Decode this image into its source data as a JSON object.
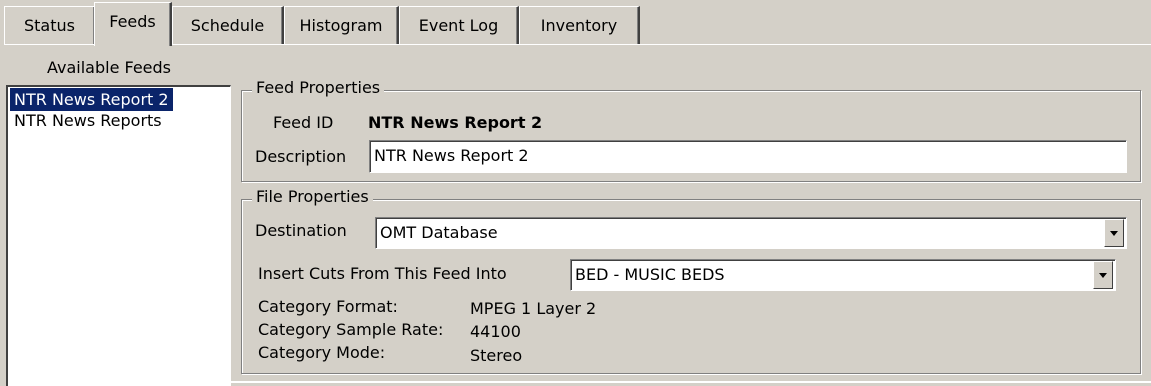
{
  "tabs": [
    "Status",
    "Feeds",
    "Schedule",
    "Histogram",
    "Event Log",
    "Inventory"
  ],
  "active_tab": "Feeds",
  "feeds_list": {
    "title": "Available Feeds",
    "items": [
      "NTR News Report 2",
      "NTR News Reports"
    ],
    "selected": "NTR News Report 2"
  },
  "feed_properties": {
    "title": "Feed Properties",
    "feed_id_label": "Feed ID",
    "feed_id_value": "NTR News Report 2",
    "description_label": "Description",
    "description_value": "NTR News Report 2"
  },
  "file_properties": {
    "title": "File Properties",
    "destination_label": "Destination",
    "destination_value": "OMT Database",
    "insert_cuts_label": "Insert Cuts From This Feed Into",
    "insert_cuts_value": "BED - MUSIC BEDS",
    "category_format_label": "Category Format:",
    "category_format_value": "MPEG 1 Layer 2",
    "category_sample_rate_label": "Category Sample Rate:",
    "category_sample_rate_value": "44100",
    "category_mode_label": "Category Mode:",
    "category_mode_value": "Stereo"
  },
  "icons": {
    "dropdown": "chevron-down-icon"
  },
  "colors": {
    "background": "#d4d0c8",
    "selection": "#0a246a",
    "selection_text": "#ffffff"
  }
}
